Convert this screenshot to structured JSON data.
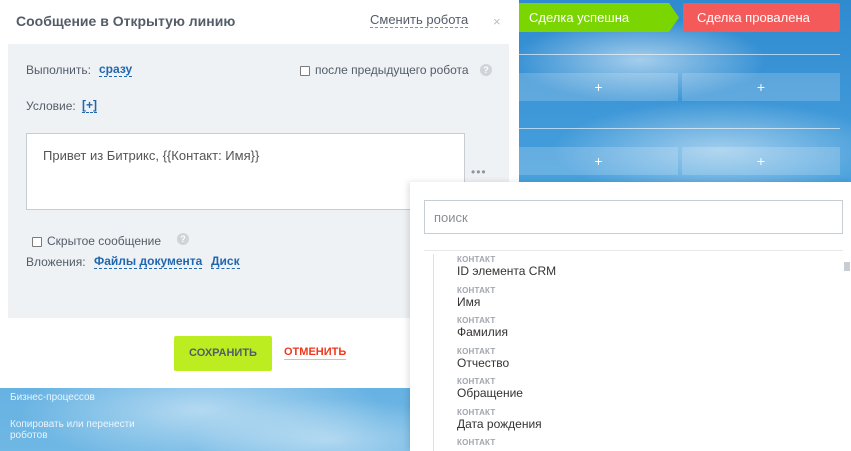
{
  "background": {
    "stages": {
      "success": "Сделка успешна",
      "fail": "Сделка провалена"
    },
    "plus": "+",
    "footer_links": [
      "Бизнес-процессов",
      "Копировать или перенести роботов"
    ],
    "colors": {
      "success": "#7bd500",
      "fail": "#f55a5a"
    }
  },
  "dialog": {
    "title": "Сообщение в Открытую линию",
    "change_robot": "Сменить робота",
    "close_icon": "×",
    "execute_label": "Выполнить:",
    "execute_value": "сразу",
    "after_previous_label": "после предыдущего робота",
    "condition_label": "Условие:",
    "condition_add": "[+]",
    "message_text": "Привет из Битрикс, {{Контакт: Имя}}",
    "dots_icon": "•••",
    "hidden_message_label": "Скрытое сообщение",
    "attachments_label": "Вложения:",
    "attachments_options": [
      "Файлы документа",
      "Диск"
    ],
    "help_icon": "?",
    "save_button": "СОХРАНИТЬ",
    "cancel_button": "ОТМЕНИТЬ",
    "colors": {
      "save": "#bbed21",
      "cancel": "#f0371c",
      "link": "#2067b0"
    }
  },
  "picker": {
    "search_placeholder": "поиск",
    "fields": [
      {
        "category": "КОНТАКТ",
        "name": "ID элемента CRM"
      },
      {
        "category": "КОНТАКТ",
        "name": "Имя"
      },
      {
        "category": "КОНТАКТ",
        "name": "Фамилия"
      },
      {
        "category": "КОНТАКТ",
        "name": "Отчество"
      },
      {
        "category": "КОНТАКТ",
        "name": "Обращение"
      },
      {
        "category": "КОНТАКТ",
        "name": "Дата рождения"
      },
      {
        "category": "КОНТАКТ",
        "name": ""
      }
    ]
  }
}
